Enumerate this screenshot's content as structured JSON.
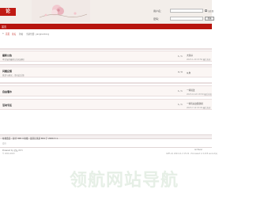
{
  "header": {
    "logo_text": "论",
    "login": {
      "username_label": "用户名：",
      "password_label": "密码：",
      "remember_label": "记住我",
      "submit_label": "登录"
    }
  },
  "nav": {
    "home_label": "首页"
  },
  "breadcrumb": [
    "首页",
    "论坛",
    "新帖",
    "当前位置: yangnenlong"
  ],
  "forums": [
    {
      "name": "最新公告",
      "desc": "本论坛的最新公告和通知",
      "stat": "1 / 1",
      "last1": "大家好",
      "last2": "2023-1-20 15:56 最后发表"
    },
    {
      "name": "问题反馈",
      "desc": "意见与建议，请在此反馈",
      "stat": "0 / 0",
      "last1": "从未",
      "last2": ""
    },
    {
      "name": "自由灌水",
      "desc": "",
      "stat": "1 / 1",
      "last1": "一些说法",
      "last2": "2023-12-20 18:59 最后发表"
    },
    {
      "name": "活动专区",
      "desc": "",
      "stat": "1 / 1",
      "last1": "一些有关这篇新闻",
      "last2": "2023-7-12 15:49 最后发表"
    }
  ],
  "online": {
    "text": "在线会员 - 总计 308 人在线 - 最高记录是 654 于 2020-7-1.",
    "sub": "会员"
  },
  "footer": {
    "left": "Powered by 论坛 X3.5",
    "right": "Archiver",
    "line_left": "© 2001-2023",
    "line_right": "GMT+8, 2024-11-3 15:22 , Processed in 0.035 second(s)"
  },
  "watermark": "领航网站导航"
}
